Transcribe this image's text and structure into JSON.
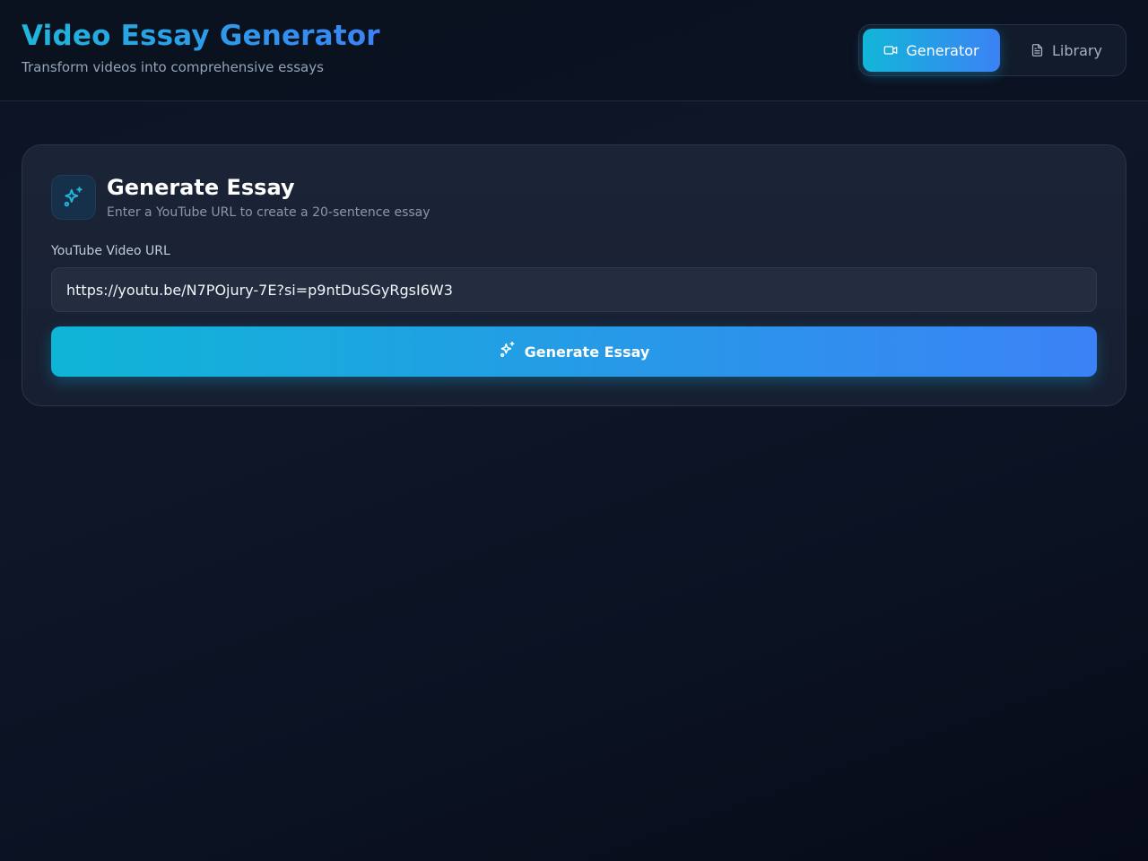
{
  "header": {
    "title": "Video Essay Generator",
    "subtitle": "Transform videos into comprehensive essays"
  },
  "nav": {
    "tabs": [
      {
        "label": "Generator",
        "icon": "video-icon",
        "active": true
      },
      {
        "label": "Library",
        "icon": "document-icon",
        "active": false
      }
    ]
  },
  "card": {
    "icon": "sparkles-icon",
    "title": "Generate Essay",
    "subtitle": "Enter a YouTube URL to create a 20-sentence essay",
    "url_label": "YouTube Video URL",
    "url_value": "https://youtu.be/N7POjury-7E?si=p9ntDuSGyRgsI6W3",
    "button_label": "Generate Essay",
    "button_icon": "sparkles-icon"
  },
  "colors": {
    "accent_start": "#0fb5d6",
    "accent_end": "#3b82f6",
    "background": "#0d1424"
  }
}
